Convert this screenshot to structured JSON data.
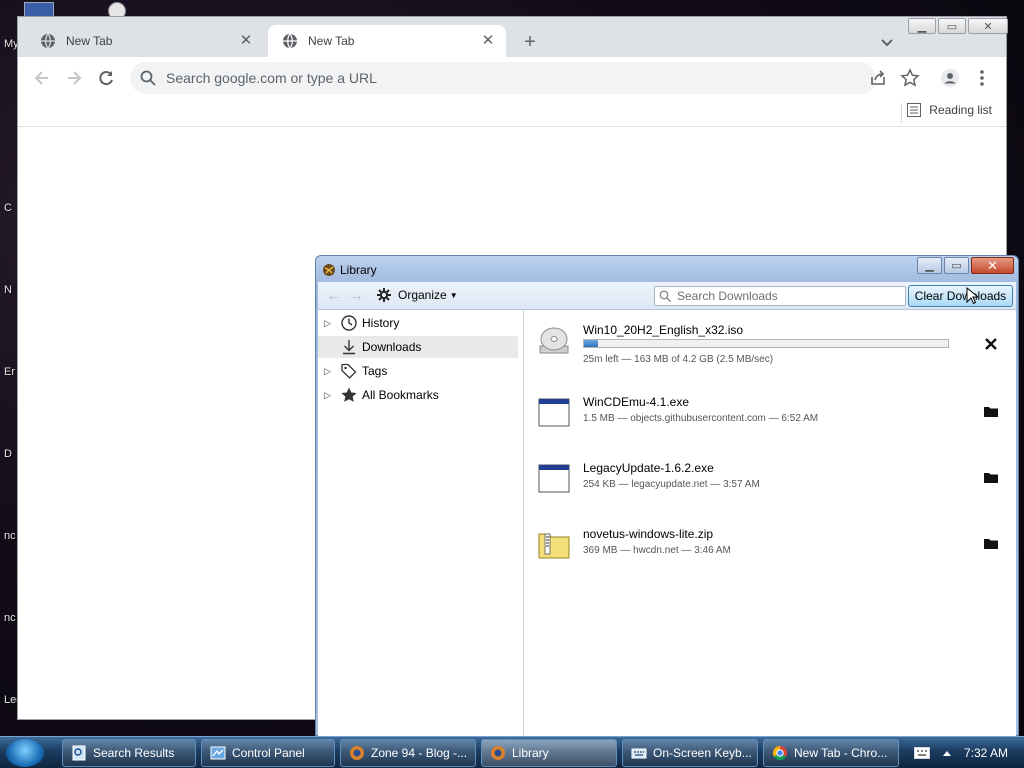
{
  "desktop": {
    "side_letters": [
      "My",
      "C",
      "N",
      "Er",
      "D",
      "nc",
      "nc",
      "Leg"
    ]
  },
  "chrome": {
    "tabs": [
      {
        "title": "New Tab",
        "active": false
      },
      {
        "title": "New Tab",
        "active": true
      }
    ],
    "omnibox_placeholder": "Search google.com or type a URL",
    "reading_list_label": "Reading list"
  },
  "library": {
    "title": "Library",
    "organize_label": "Organize",
    "search_placeholder": "Search Downloads",
    "clear_button_label": "Clear Downloads",
    "sidebar": [
      {
        "label": "History",
        "expandable": true,
        "icon": "clock-icon"
      },
      {
        "label": "Downloads",
        "expandable": false,
        "icon": "download-arrow-icon",
        "selected": true
      },
      {
        "label": "Tags",
        "expandable": true,
        "icon": "tag-icon"
      },
      {
        "label": "All Bookmarks",
        "expandable": true,
        "icon": "star-icon"
      }
    ],
    "downloads": [
      {
        "name": "Win10_20H2_English_x32.iso",
        "status": "25m left — 163 MB of 4.2 GB (2.5 MB/sec)",
        "in_progress": true,
        "progress_fraction": 0.038,
        "icon": "disc-icon",
        "action": "cancel"
      },
      {
        "name": "WinCDEmu-4.1.exe",
        "status": "1.5 MB — objects.githubusercontent.com — 6:52 AM",
        "in_progress": false,
        "icon": "exe-icon",
        "action": "open-folder"
      },
      {
        "name": "LegacyUpdate-1.6.2.exe",
        "status": "254 KB — legacyupdate.net — 3:57 AM",
        "in_progress": false,
        "icon": "exe-icon",
        "action": "open-folder"
      },
      {
        "name": "novetus-windows-lite.zip",
        "status": "369 MB — hwcdn.net — 3:46 AM",
        "in_progress": false,
        "icon": "zip-icon",
        "action": "open-folder"
      }
    ]
  },
  "taskbar": {
    "tasks": [
      {
        "label": "Search Results",
        "icon": "search-results-icon",
        "active": false
      },
      {
        "label": "Control Panel",
        "icon": "control-panel-icon",
        "active": false
      },
      {
        "label": "Zone 94 - Blog -...",
        "icon": "firefox-icon",
        "active": false
      },
      {
        "label": "Library",
        "icon": "firefox-icon",
        "active": true
      },
      {
        "label": "On-Screen Keyb...",
        "icon": "keyboard-icon",
        "active": false
      },
      {
        "label": "New Tab - Chro...",
        "icon": "chrome-icon",
        "active": false
      }
    ],
    "clock": "7:32 AM"
  }
}
